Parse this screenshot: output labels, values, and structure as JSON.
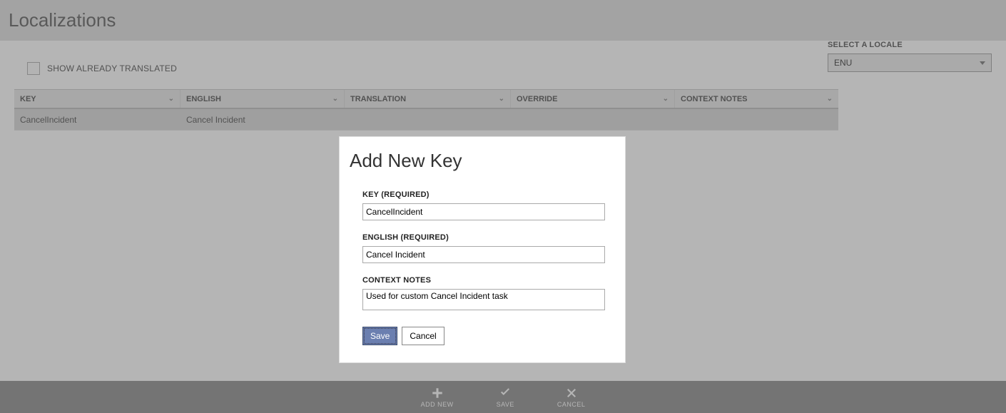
{
  "header": {
    "title": "Localizations"
  },
  "checkbox": {
    "label": "SHOW ALREADY TRANSLATED"
  },
  "locale": {
    "label": "SELECT A LOCALE",
    "value": "ENU"
  },
  "table": {
    "cols": {
      "key": "KEY",
      "english": "ENGLISH",
      "translation": "TRANSLATION",
      "override": "OVERRIDE",
      "context": "CONTEXT NOTES"
    },
    "rows": [
      {
        "key": "CancelIncident",
        "english": "Cancel Incident",
        "translation": "",
        "override": "",
        "context": ""
      }
    ]
  },
  "bottombar": {
    "add": "ADD NEW",
    "save": "SAVE",
    "cancel": "CANCEL"
  },
  "modal": {
    "title": "Add New Key",
    "key_label": "KEY (REQUIRED)",
    "key_value": "CancelIncident",
    "english_label": "ENGLISH (REQUIRED)",
    "english_value": "Cancel Incident",
    "context_label": "CONTEXT NOTES",
    "context_value": "Used for custom Cancel Incident task",
    "save": "Save",
    "cancel": "Cancel"
  }
}
